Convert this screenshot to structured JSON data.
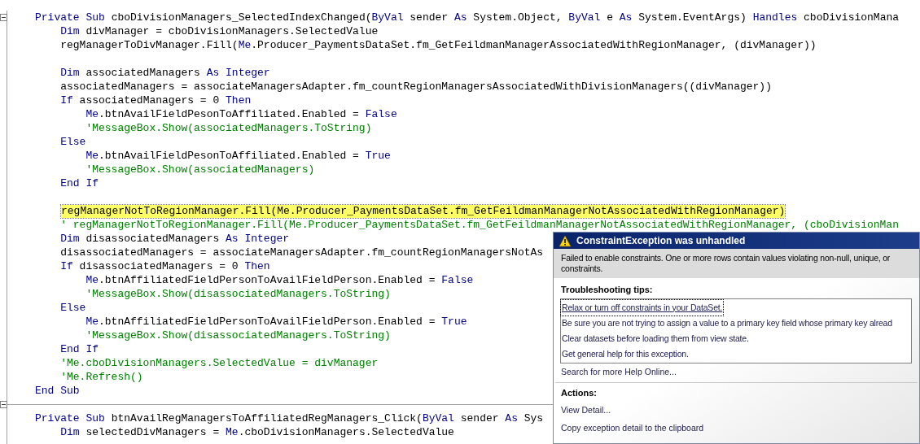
{
  "editor": {
    "procedures": [
      {
        "blocks": [
          {
            "lines": [
              {
                "tokens": [
                  {
                    "kind": "keyword",
                    "text": "Private Sub"
                  },
                  {
                    "kind": "plain",
                    "text": " cboDivisionManagers_SelectedIndexChanged("
                  },
                  {
                    "kind": "keyword",
                    "text": "ByVal"
                  },
                  {
                    "kind": "plain",
                    "text": " sender "
                  },
                  {
                    "kind": "keyword",
                    "text": "As"
                  },
                  {
                    "kind": "plain",
                    "text": " System.Object, "
                  },
                  {
                    "kind": "keyword",
                    "text": "ByVal"
                  },
                  {
                    "kind": "plain",
                    "text": " e "
                  },
                  {
                    "kind": "keyword",
                    "text": "As"
                  },
                  {
                    "kind": "plain",
                    "text": " System.EventArgs) "
                  },
                  {
                    "kind": "keyword",
                    "text": "Handles"
                  },
                  {
                    "kind": "plain",
                    "text": " cboDivisionMana"
                  }
                ]
              },
              {
                "tokens": [
                  {
                    "kind": "keyword",
                    "text": "    Dim"
                  },
                  {
                    "kind": "plain",
                    "text": " divManager = cboDivisionManagers.SelectedValue"
                  }
                ]
              },
              {
                "tokens": [
                  {
                    "kind": "plain",
                    "text": "    regManagerToDivManager.Fill("
                  },
                  {
                    "kind": "keyword",
                    "text": "Me"
                  },
                  {
                    "kind": "plain",
                    "text": ".Producer_PaymentsDataSet.fm_GetFeildmanManagerAssociatedWithRegionManager, (divManager))"
                  }
                ]
              }
            ]
          },
          {
            "lines": [
              {
                "tokens": [
                  {
                    "kind": "keyword",
                    "text": "    Dim"
                  },
                  {
                    "kind": "plain",
                    "text": " associatedManagers "
                  },
                  {
                    "kind": "keyword",
                    "text": "As Integer"
                  }
                ]
              },
              {
                "tokens": [
                  {
                    "kind": "plain",
                    "text": "    associatedManagers = associateManagersAdapter.fm_countRegionManagersAssociatedWithDivisionManagers((divManager))"
                  }
                ]
              },
              {
                "tokens": [
                  {
                    "kind": "keyword",
                    "text": "    If"
                  },
                  {
                    "kind": "plain",
                    "text": " associatedManagers = 0 "
                  },
                  {
                    "kind": "keyword",
                    "text": "Then"
                  }
                ]
              },
              {
                "tokens": [
                  {
                    "kind": "keyword",
                    "text": "        Me"
                  },
                  {
                    "kind": "plain",
                    "text": ".btnAvailFieldPesonToAffiliated.Enabled = "
                  },
                  {
                    "kind": "keyword",
                    "text": "False"
                  }
                ]
              },
              {
                "tokens": [
                  {
                    "kind": "comment",
                    "text": "        'MessageBox.Show(associatedManagers.ToString)"
                  }
                ]
              },
              {
                "tokens": [
                  {
                    "kind": "keyword",
                    "text": "    Else"
                  }
                ]
              },
              {
                "tokens": [
                  {
                    "kind": "keyword",
                    "text": "        Me"
                  },
                  {
                    "kind": "plain",
                    "text": ".btnAvailFieldPesonToAffiliated.Enabled = "
                  },
                  {
                    "kind": "keyword",
                    "text": "True"
                  }
                ]
              },
              {
                "tokens": [
                  {
                    "kind": "comment",
                    "text": "        'MessageBox.Show(associatedManagers)"
                  }
                ]
              },
              {
                "tokens": [
                  {
                    "kind": "keyword",
                    "text": "    End If"
                  }
                ]
              }
            ]
          },
          {
            "lines": [
              {
                "highlighted": true,
                "tokens": [
                  {
                    "kind": "plain",
                    "text": "regManagerNotToRegionManager.Fill(Me.Producer_PaymentsDataSet.fm_GetFeildmanManagerNotAssociatedWithRegionManager)"
                  }
                ]
              },
              {
                "tokens": [
                  {
                    "kind": "comment",
                    "text": "    ' regManagerNotToRegionManager.Fill(Me.Producer_PaymentsDataSet.fm_GetFeildmanManagerNotAssociatedWithRegionManager, (cboDivisionMan"
                  }
                ]
              },
              {
                "tokens": [
                  {
                    "kind": "keyword",
                    "text": "    Dim"
                  },
                  {
                    "kind": "plain",
                    "text": " disassociatedManagers "
                  },
                  {
                    "kind": "keyword",
                    "text": "As Integer"
                  }
                ]
              },
              {
                "tokens": [
                  {
                    "kind": "plain",
                    "text": "    disassociatedManagers = associateManagersAdapter.fm_countRegionManagersNotAs"
                  }
                ]
              },
              {
                "tokens": [
                  {
                    "kind": "keyword",
                    "text": "    If"
                  },
                  {
                    "kind": "plain",
                    "text": " disassociatedManagers = 0 "
                  },
                  {
                    "kind": "keyword",
                    "text": "Then"
                  }
                ]
              },
              {
                "tokens": [
                  {
                    "kind": "keyword",
                    "text": "        Me"
                  },
                  {
                    "kind": "plain",
                    "text": ".btnAffiliatedFieldPersonToAvailFieldPerson.Enabled = "
                  },
                  {
                    "kind": "keyword",
                    "text": "False"
                  }
                ]
              },
              {
                "tokens": [
                  {
                    "kind": "comment",
                    "text": "        'MessageBox.Show(disassociatedManagers.ToString)"
                  }
                ]
              },
              {
                "tokens": [
                  {
                    "kind": "keyword",
                    "text": "    Else"
                  }
                ]
              },
              {
                "tokens": [
                  {
                    "kind": "keyword",
                    "text": "        Me"
                  },
                  {
                    "kind": "plain",
                    "text": ".btnAffiliatedFieldPersonToAvailFieldPerson.Enabled = "
                  },
                  {
                    "kind": "keyword",
                    "text": "True"
                  }
                ]
              },
              {
                "tokens": [
                  {
                    "kind": "comment",
                    "text": "        'MessageBox.Show(disassociatedManagers.ToString)"
                  }
                ]
              },
              {
                "tokens": [
                  {
                    "kind": "keyword",
                    "text": "    End If"
                  }
                ]
              },
              {
                "tokens": [
                  {
                    "kind": "comment",
                    "text": "    'Me.cboDivisionManagers.SelectedValue = divManager"
                  }
                ]
              },
              {
                "tokens": [
                  {
                    "kind": "comment",
                    "text": "    'Me.Refresh()"
                  }
                ]
              },
              {
                "tokens": [
                  {
                    "kind": "keyword",
                    "text": "End Sub"
                  }
                ]
              }
            ]
          }
        ]
      },
      {
        "blocks": [
          {
            "lines": [
              {
                "tokens": [
                  {
                    "kind": "keyword",
                    "text": "Private Sub"
                  },
                  {
                    "kind": "plain",
                    "text": " btnAvailRegManagersToAffiliatedRegManagers_Click("
                  },
                  {
                    "kind": "keyword",
                    "text": "ByVal"
                  },
                  {
                    "kind": "plain",
                    "text": " sender "
                  },
                  {
                    "kind": "keyword",
                    "text": "As"
                  },
                  {
                    "kind": "plain",
                    "text": " Sys"
                  }
                ]
              },
              {
                "tokens": [
                  {
                    "kind": "keyword",
                    "text": "    Dim"
                  },
                  {
                    "kind": "plain",
                    "text": " selectedDivManagers = "
                  },
                  {
                    "kind": "keyword",
                    "text": "Me"
                  },
                  {
                    "kind": "plain",
                    "text": ".cboDivisionManagers.SelectedValue"
                  }
                ]
              }
            ]
          }
        ]
      }
    ]
  },
  "exception_dialog": {
    "title": "ConstraintException was unhandled",
    "message": "Failed to enable constraints. One or more rows contain values violating non-null, unique, or constraints.",
    "tips_heading": "Troubleshooting tips:",
    "tips": [
      {
        "text": "Relax or turn off constraints in your DataSet.",
        "selected": true
      },
      {
        "text": "Be sure you are not trying to assign a value to a primary key field whose primary key alread",
        "selected": false
      },
      {
        "text": "Clear datasets before loading them from view state.",
        "selected": false
      },
      {
        "text": "Get general help for this exception.",
        "selected": false
      }
    ],
    "search_link": "Search for more Help Online...",
    "actions_heading": "Actions:",
    "actions": [
      "View Detail...",
      "Copy exception detail to the clipboard"
    ]
  }
}
